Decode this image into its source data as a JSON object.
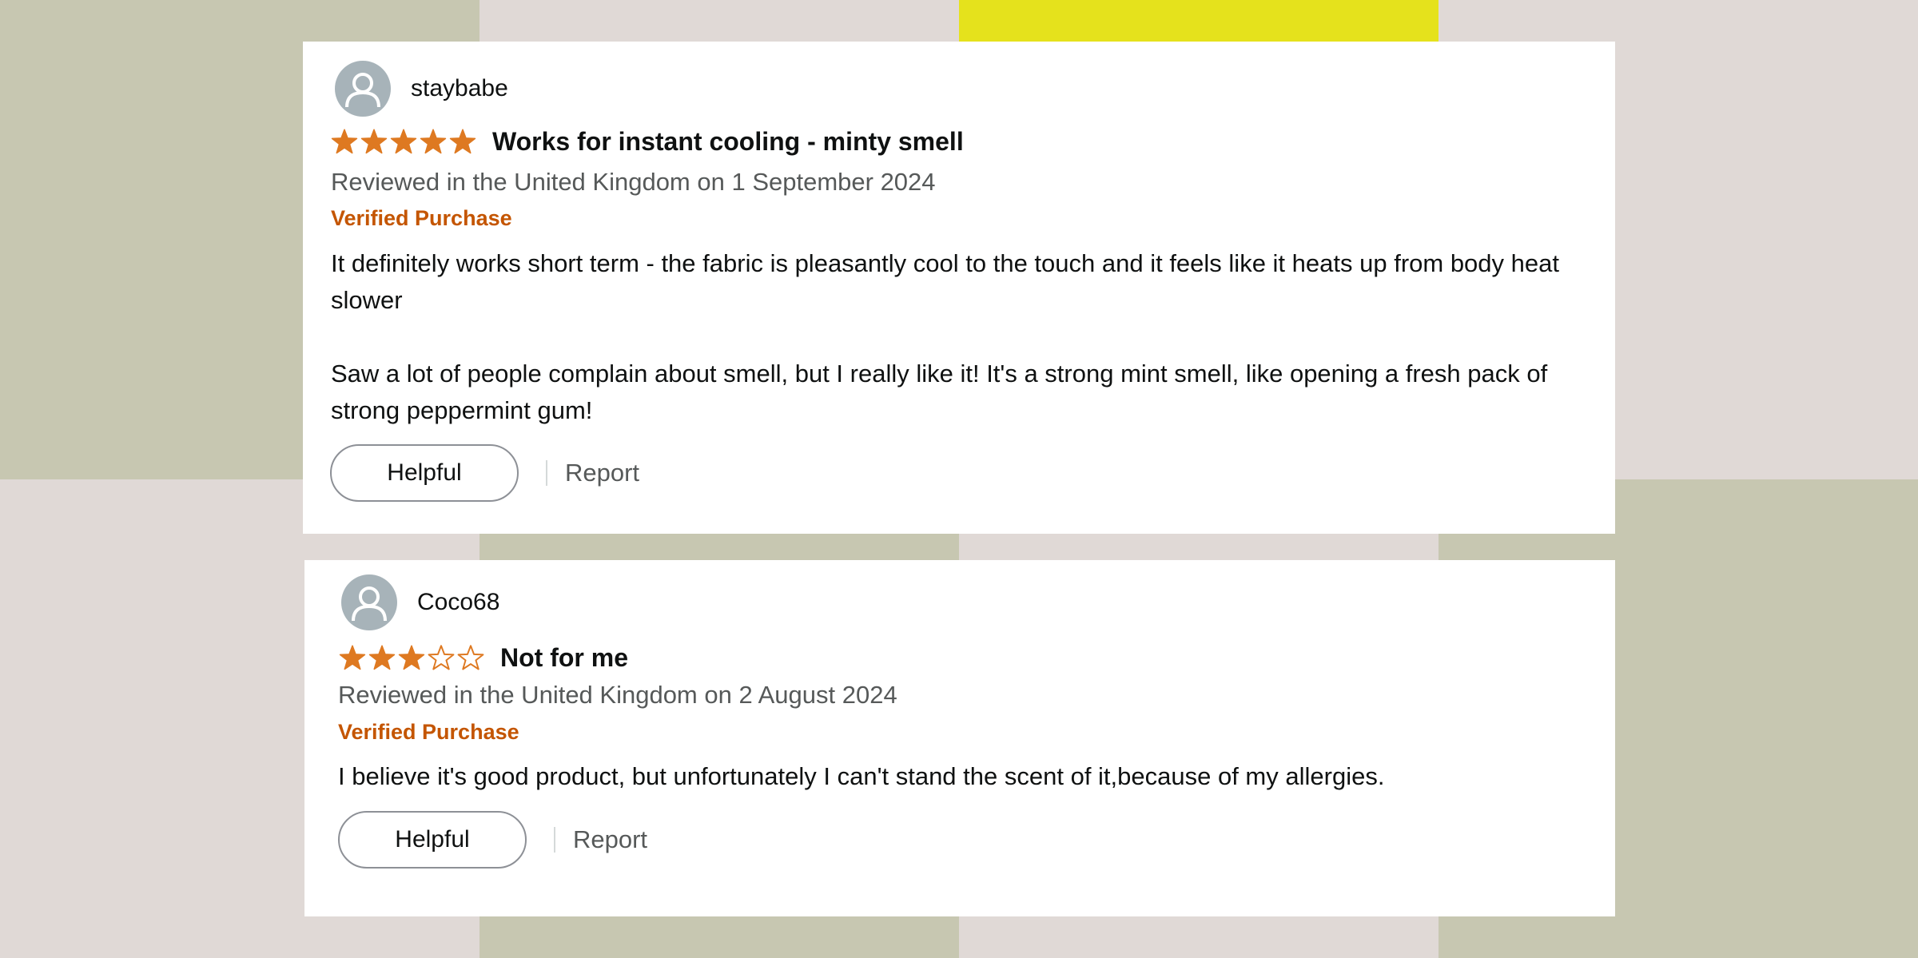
{
  "background": {
    "colors": {
      "sage": "#c7c7b1",
      "blush": "#e0d9d6",
      "lime": "#e5e21c"
    }
  },
  "colors": {
    "star": "#de7921",
    "verified": "#c45500",
    "muted_text": "#565959",
    "avatar": "#a7b3b9"
  },
  "reviews": [
    {
      "username": "staybabe",
      "rating": 5,
      "max_rating": 5,
      "title": "Works for instant cooling - minty smell",
      "date": "Reviewed in the United Kingdom on 1 September 2024",
      "verified": "Verified Purchase",
      "body": [
        "It definitely works short term - the fabric is pleasantly cool to the touch and it feels like it heats up from body heat slower",
        "Saw a lot of people complain about smell, but I really like it! It's a strong mint smell, like opening a fresh pack of strong peppermint gum!"
      ],
      "helpful_label": "Helpful",
      "report_label": "Report"
    },
    {
      "username": "Coco68",
      "rating": 3,
      "max_rating": 5,
      "title": "Not for me",
      "date": "Reviewed in the United Kingdom on 2 August 2024",
      "verified": "Verified Purchase",
      "body": [
        "I believe it's good product, but unfortunately I can't stand the scent of it,because of my allergies."
      ],
      "helpful_label": "Helpful",
      "report_label": "Report"
    }
  ]
}
